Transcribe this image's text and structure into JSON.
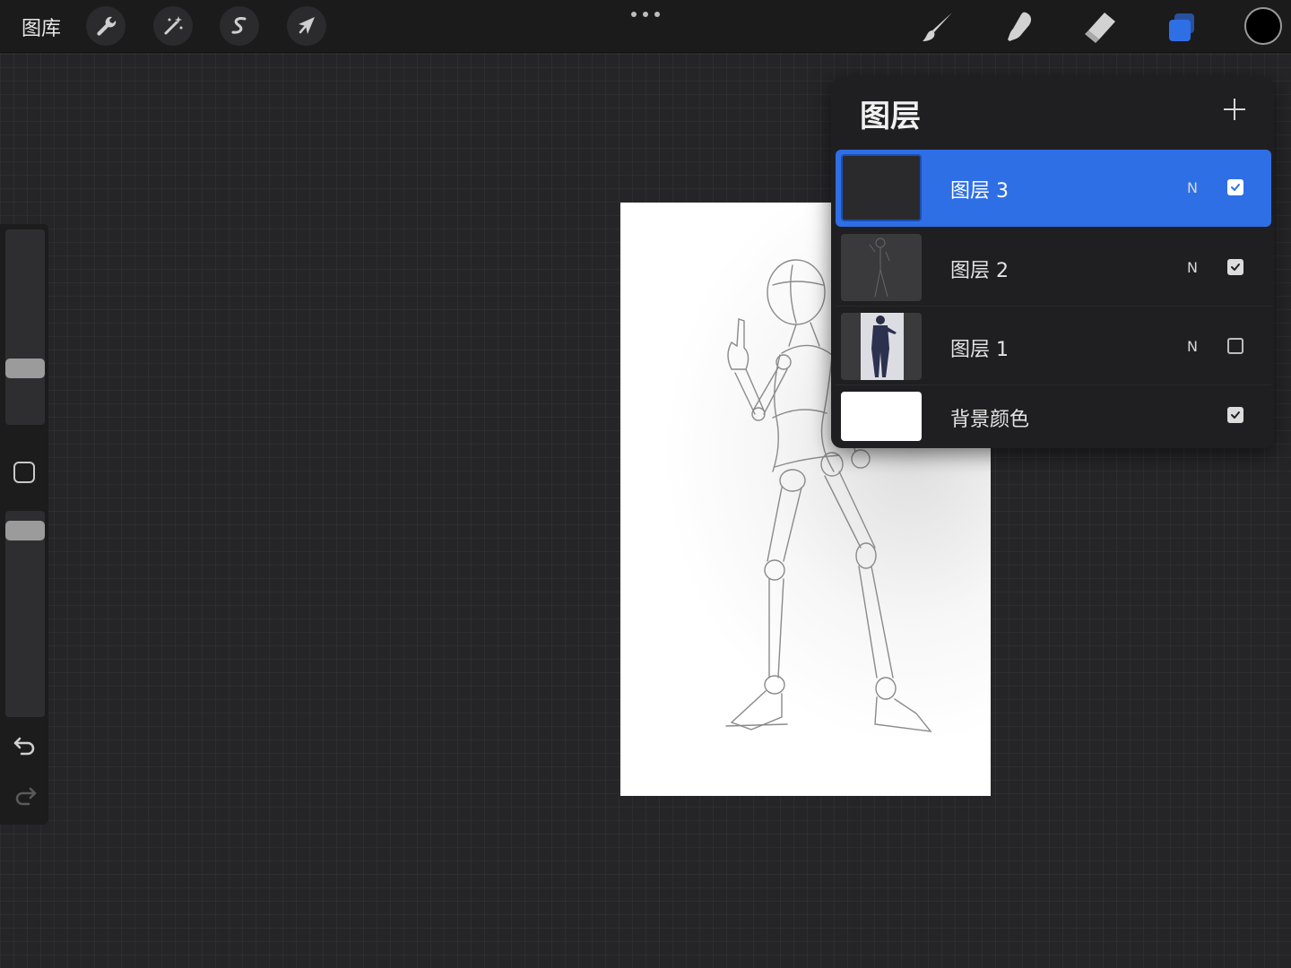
{
  "toolbar": {
    "gallery_label": "图库",
    "left_tools": [
      {
        "name": "actions",
        "icon": "wrench-icon"
      },
      {
        "name": "adjustments",
        "icon": "magic-wand-icon"
      },
      {
        "name": "selection",
        "icon": "selection-s-icon"
      },
      {
        "name": "transform",
        "icon": "arrow-cursor-icon"
      }
    ],
    "more_icon": "ellipsis-icon",
    "right_tools": [
      {
        "name": "brush",
        "icon": "brush-icon"
      },
      {
        "name": "smudge",
        "icon": "smudge-finger-icon"
      },
      {
        "name": "eraser",
        "icon": "eraser-icon"
      },
      {
        "name": "layers",
        "icon": "layers-icon",
        "active_color": "#2f6fe6"
      }
    ],
    "current_color": "#000000"
  },
  "sidebar": {
    "brush_size_level": 0.7,
    "opacity_level": 1.0,
    "undo_icon": "undo-icon",
    "redo_icon": "redo-icon"
  },
  "layers_panel": {
    "title": "图层",
    "add_icon": "plus-icon",
    "layers": [
      {
        "name": "图层 3",
        "blend": "N",
        "visible": true,
        "selected": true
      },
      {
        "name": "图层 2",
        "blend": "N",
        "visible": true,
        "selected": false
      },
      {
        "name": "图层 1",
        "blend": "N",
        "visible": false,
        "selected": false
      },
      {
        "name": "背景颜色",
        "blend": "",
        "visible": true,
        "selected": false
      }
    ],
    "accent": "#2f6fe6"
  }
}
